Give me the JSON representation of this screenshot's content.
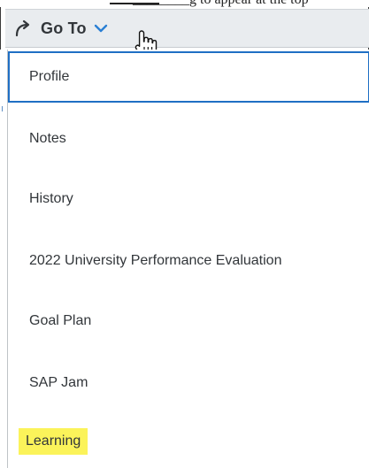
{
  "header": {
    "cropped_text": "________g to appear at the top"
  },
  "goto": {
    "label": "Go To"
  },
  "menu": {
    "items": [
      {
        "label": "Profile"
      },
      {
        "label": "Notes"
      },
      {
        "label": "History"
      },
      {
        "label": "2022 University Performance Evaluation"
      },
      {
        "label": "Goal Plan"
      },
      {
        "label": "SAP Jam"
      },
      {
        "label": "Learning"
      }
    ]
  },
  "colors": {
    "focus_border": "#1f6fc4",
    "highlight": "#fbf35a",
    "toolbar_bg": "#e9ecef",
    "text": "#32363a",
    "accent_chevron": "#2a7fd4"
  },
  "icons": {
    "goto": "share-arrow-icon",
    "expand": "chevron-down-icon",
    "pointer": "hand-cursor-icon"
  }
}
